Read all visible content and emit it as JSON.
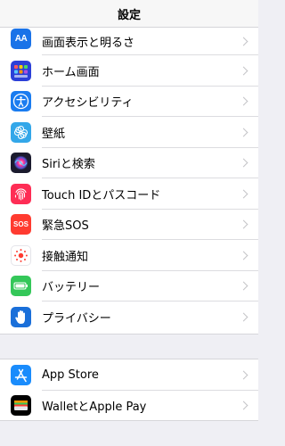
{
  "nav": {
    "title": "設定"
  },
  "colors": {
    "display": "#1a73e8",
    "home": "#2c40d8",
    "accessibility": "#1a7cf0",
    "wallpaper": "#33a7e9",
    "siri": "#1b1b2e",
    "touchid": "#fe2d55",
    "sos": "#ff3b30",
    "exposure": "#ffffff",
    "battery": "#34c759",
    "privacy": "#1a6fd9",
    "appstore": "#1a8cfc",
    "wallet": "#000000"
  },
  "group1": [
    {
      "label": "画面表示と明るさ",
      "icon": "display-brightness-icon",
      "glyph": "AA"
    },
    {
      "label": "ホーム画面",
      "icon": "home-screen-icon",
      "glyph": ""
    },
    {
      "label": "アクセシビリティ",
      "icon": "accessibility-icon",
      "glyph": ""
    },
    {
      "label": "壁紙",
      "icon": "wallpaper-icon",
      "glyph": ""
    },
    {
      "label": "Siriと検索",
      "icon": "siri-icon",
      "glyph": ""
    },
    {
      "label": "Touch IDとパスコード",
      "icon": "fingerprint-icon",
      "glyph": ""
    },
    {
      "label": "緊急SOS",
      "icon": "sos-icon",
      "glyph": "SOS"
    },
    {
      "label": "接触通知",
      "icon": "exposure-notification-icon",
      "glyph": ""
    },
    {
      "label": "バッテリー",
      "icon": "battery-icon",
      "glyph": ""
    },
    {
      "label": "プライバシー",
      "icon": "hand-icon",
      "glyph": ""
    }
  ],
  "group2": [
    {
      "label": "App Store",
      "icon": "app-store-icon",
      "glyph": ""
    },
    {
      "label": "WalletとApple Pay",
      "icon": "wallet-icon",
      "glyph": ""
    }
  ]
}
